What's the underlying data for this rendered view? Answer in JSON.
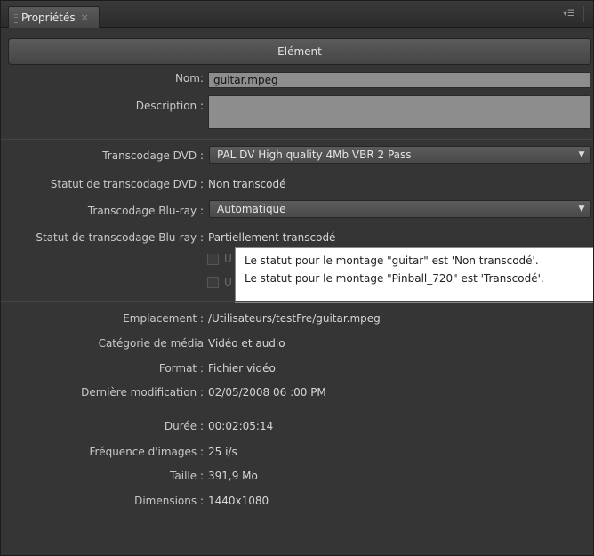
{
  "tab": {
    "title": "Propriétés",
    "close": "×",
    "menu_icon": "panel-menu-icon"
  },
  "section": {
    "title": "Elément"
  },
  "fields": {
    "nom_label": "Nom:",
    "nom_value": "guitar.mpeg",
    "description_label": "Description :",
    "description_value": ""
  },
  "transcode": {
    "dvd_label": "Transcodage DVD :",
    "dvd_value": "PAL DV High quality 4Mb VBR 2 Pass",
    "dvd_status_label": "Statut de transcodage DVD :",
    "dvd_status_value": "Non transcodé",
    "bluray_label": "Transcodage Blu-ray :",
    "bluray_value": "Automatique",
    "bluray_status_label": "Statut de transcodage Blu-ray :",
    "bluray_status_value": "Partiellement transcodé",
    "checkbox1_text": "U",
    "checkbox2_text": "U"
  },
  "tooltip": {
    "line1": "Le statut pour le montage \"guitar\" est 'Non transcodé'.",
    "line2": "Le statut pour le montage \"Pinball_720\" est 'Transcodé'."
  },
  "file_info": {
    "emplacement_label": "Emplacement :",
    "emplacement_value": "/Utilisateurs/testFre/guitar.mpeg",
    "categorie_label": "Catégorie de média",
    "categorie_value": "Vidéo et audio",
    "format_label": "Format :",
    "format_value": "Fichier vidéo",
    "modif_label": "Dernière modification :",
    "modif_value": "02/05/2008 06 :00 PM"
  },
  "media_info": {
    "duree_label": "Durée :",
    "duree_value": "00:02:05:14",
    "freq_label": "Fréquence d'images :",
    "freq_value": "25 i/s",
    "taille_label": "Taille :",
    "taille_value": "391,9 Mo",
    "dim_label": "Dimensions :",
    "dim_value": "1440x1080"
  },
  "colors": {
    "panel_bg": "#353535",
    "field_bg": "#8d8d8d",
    "tooltip_bg": "#ffffff"
  }
}
